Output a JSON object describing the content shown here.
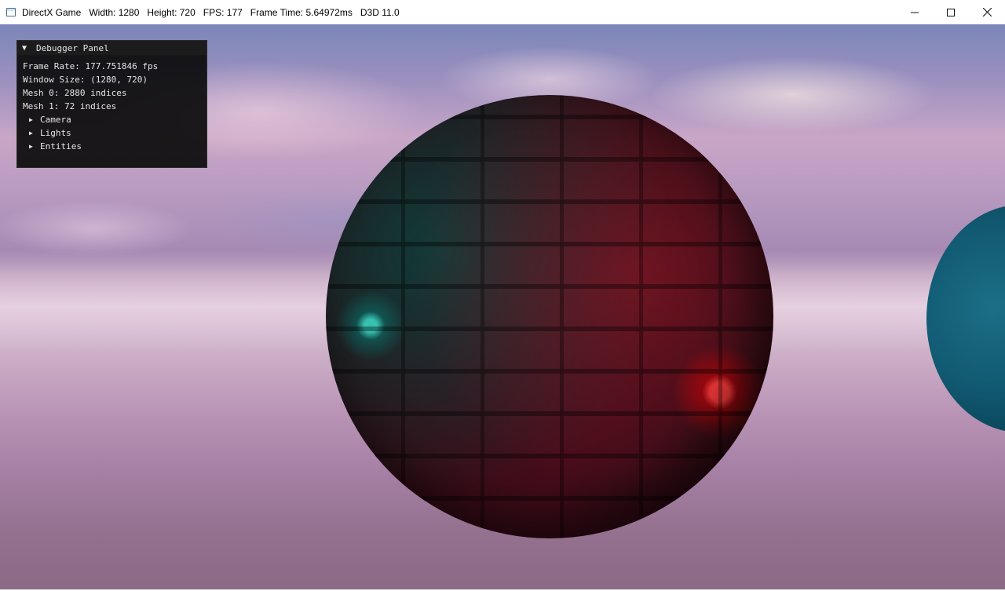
{
  "window": {
    "title": "DirectX Game   Width: 1280   Height: 720   FPS: 177   Frame Time: 5.64972ms   D3D 11.0",
    "controls": {
      "minimize": "minimize-icon",
      "maximize": "maximize-icon",
      "close": "close-icon"
    }
  },
  "debugger": {
    "title": "Debugger Panel",
    "expanded_icon": "triangle-down-icon",
    "stats": {
      "frame_rate": "Frame Rate: 177.751846 fps",
      "window_size": "Window Size: (1280, 720)",
      "mesh0": "Mesh 0: 2880 indices",
      "mesh1": "Mesh 1: 72 indices"
    },
    "tree": [
      {
        "label": "Camera",
        "icon": "triangle-right-icon"
      },
      {
        "label": "Lights",
        "icon": "triangle-right-icon"
      },
      {
        "label": "Entities",
        "icon": "triangle-right-icon"
      }
    ]
  },
  "colors": {
    "red_light": "#ff2020",
    "teal_light": "#30d0c0",
    "side_sphere": "#115a72",
    "panel_bg": "#0c0c0c"
  }
}
